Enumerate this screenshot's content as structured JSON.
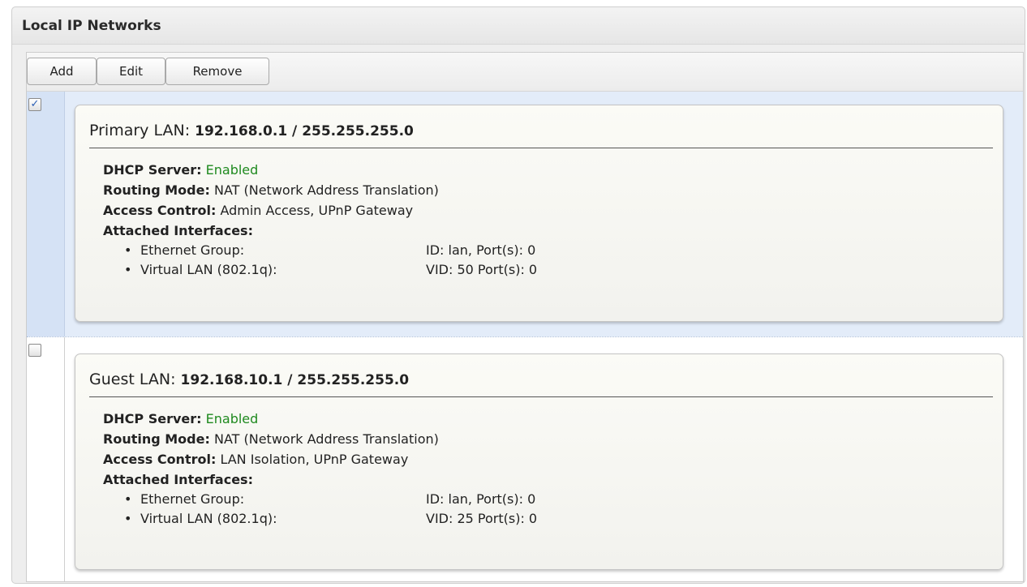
{
  "panel": {
    "title": "Local IP Networks"
  },
  "toolbar": {
    "add": "Add",
    "edit": "Edit",
    "remove": "Remove"
  },
  "labels": {
    "dhcp": "DHCP Server:",
    "routing": "Routing Mode:",
    "access": "Access Control:",
    "interfaces": "Attached Interfaces:"
  },
  "networks": [
    {
      "checked": true,
      "name": "Primary LAN:",
      "ip": "192.168.0.1 / 255.255.255.0",
      "dhcp": "Enabled",
      "routing": "NAT (Network Address Translation)",
      "access": "Admin Access, UPnP Gateway",
      "interfaces": [
        {
          "name": "Ethernet Group:",
          "value": "ID: lan, Port(s): 0"
        },
        {
          "name": "Virtual LAN (802.1q):",
          "value": "VID: 50 Port(s): 0"
        }
      ]
    },
    {
      "checked": false,
      "name": "Guest LAN:",
      "ip": "192.168.10.1 / 255.255.255.0",
      "dhcp": "Enabled",
      "routing": "NAT (Network Address Translation)",
      "access": "LAN Isolation, UPnP Gateway",
      "interfaces": [
        {
          "name": "Ethernet Group:",
          "value": "ID: lan, Port(s): 0"
        },
        {
          "name": "Virtual LAN (802.1q):",
          "value": "VID: 25 Port(s): 0"
        }
      ]
    }
  ],
  "colors": {
    "enabled": "#1f8a1f",
    "selected_row": "#e3ecf9"
  },
  "icons": {
    "bullet": "bullet-icon",
    "check": "checkmark-icon"
  }
}
